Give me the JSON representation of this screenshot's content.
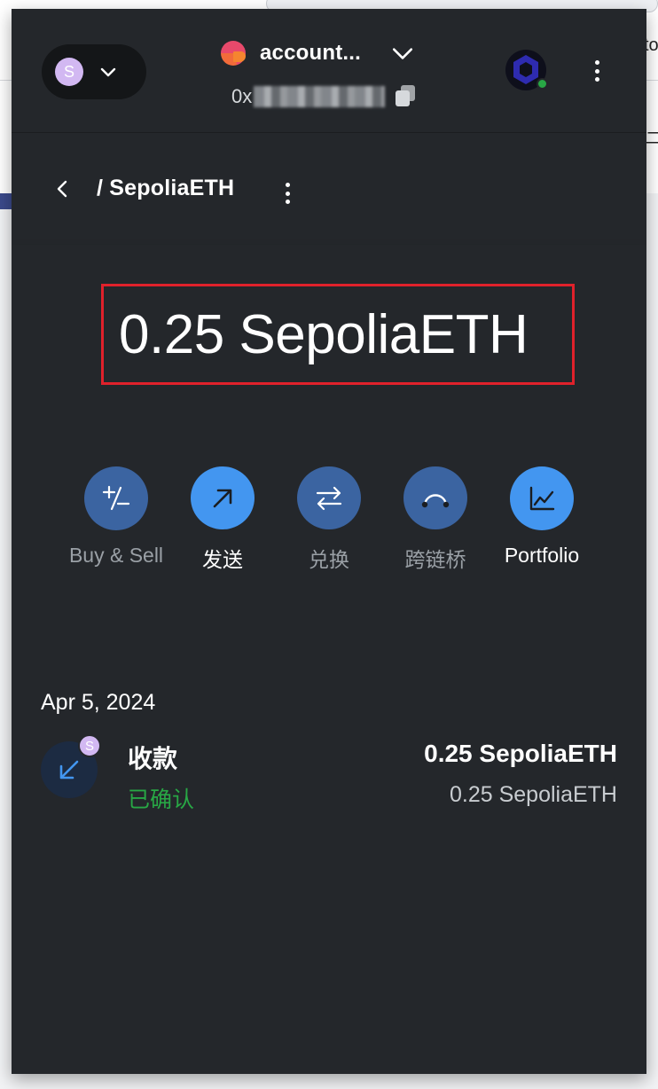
{
  "background_page": {
    "right_edge_text": "to",
    "right_edge_mark": "二"
  },
  "header": {
    "network_avatar_letter": "S",
    "account_name": "account...",
    "address_prefix": "0x",
    "snap_icon": "hexagon-icon"
  },
  "breadcrumb": {
    "title": "/ SepoliaETH"
  },
  "balance": {
    "text": "0.25 SepoliaETH"
  },
  "actions": [
    {
      "label": "Buy & Sell",
      "icon": "plus-minus-icon",
      "highlighted": false
    },
    {
      "label": "发送",
      "icon": "arrow-up-right-icon",
      "highlighted": true
    },
    {
      "label": "兑换",
      "icon": "swap-arrows-icon",
      "highlighted": false
    },
    {
      "label": "跨链桥",
      "icon": "bridge-icon",
      "highlighted": false
    },
    {
      "label": "Portfolio",
      "icon": "chart-line-icon",
      "highlighted": true
    }
  ],
  "activity": {
    "date": "Apr 5, 2024",
    "transactions": [
      {
        "title": "收款",
        "status": "已确认",
        "amount": "0.25 SepoliaETH",
        "fiat": "0.25 SepoliaETH",
        "badge_letter": "S",
        "icon": "arrow-down-left-icon"
      }
    ]
  },
  "colors": {
    "popup_bg": "#24272b",
    "accent_blue": "#4396f0",
    "muted_blue": "#3b64a1",
    "success_green": "#28a745",
    "highlight_red": "#e0212b",
    "avatar_purple": "#d2b8f2"
  }
}
